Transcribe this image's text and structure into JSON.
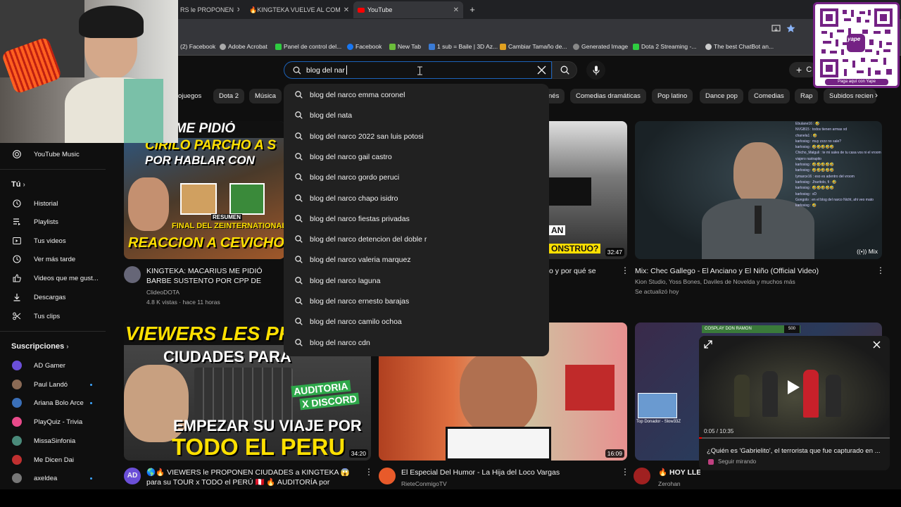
{
  "browser": {
    "tabs": [
      {
        "title": "RS le PROPONEN"
      },
      {
        "title": "🔥KINGTEKA VUELVE AL COM"
      },
      {
        "title": "YouTube"
      }
    ],
    "bookmarks": [
      "(2) Facebook",
      "Adobe Acrobat",
      "Panel de control del...",
      "Facebook",
      "New Tab",
      "1 sub = Baile | 3D Az...",
      "Cambiar Tamaño de...",
      "Generated Image",
      "Dota 2 Streaming -...",
      "The best ChatBot an..."
    ]
  },
  "search": {
    "query": "blog del nar",
    "suggestions": [
      "blog del narco emma coronel",
      "blog del nata",
      "blog del narco 2022 san luis potosi",
      "blog del narco gail castro",
      "blog del narco gordo peruci",
      "blog del narco chapo isidro",
      "blog del narco fiestas privadas",
      "blog del narco detencion del doble r",
      "blog del narco valeria marquez",
      "blog del narco laguna",
      "blog del narco ernesto barajas",
      "blog del narco camilo ochoa",
      "blog del narco cdn"
    ]
  },
  "header": {
    "create_label": "C"
  },
  "chips": [
    "ojuegos",
    "Dota 2",
    "Música",
    "nés",
    "Comedias dramáticas",
    "Pop latino",
    "Dance pop",
    "Comedias",
    "Rap",
    "Subidos recien"
  ],
  "sidebar": {
    "youtube_music": "YouTube Music",
    "you_section": "Tú",
    "items": [
      "Historial",
      "Playlists",
      "Tus videos",
      "Ver más tarde",
      "Videos que me gust...",
      "Descargas",
      "Tus clips"
    ],
    "subs_section": "Suscripciones",
    "subscriptions": [
      {
        "name": "AD Gamer",
        "color": "#6b4fd8",
        "new": false
      },
      {
        "name": "Paul Landó",
        "color": "#8a6a55",
        "new": true
      },
      {
        "name": "Ariana Bolo Arce",
        "color": "#3a6fb8",
        "new": true
      },
      {
        "name": "PlayQuiz - Trivia",
        "color": "#e84a8a",
        "new": false
      },
      {
        "name": "MissaSinfonia",
        "color": "#4a8a7a",
        "new": false
      },
      {
        "name": "Me Dicen Dai",
        "color": "#c03030",
        "new": false
      },
      {
        "name": "axeldea",
        "color": "#777777",
        "new": true
      }
    ]
  },
  "videos": {
    "v1": {
      "thumb_text": [
        "RIUS ME PIDIÓ",
        "CIRILO PARCHO A S",
        "POR HABLAR CON",
        "RESUMEN",
        "FINAL DEL ZEINTERNATIONAL",
        "REACCION A CEVICHON!!"
      ],
      "title": "KINGTEKA: MACARIUS ME PIDIÓ BARBE SUSTENTO POR CPP DE SIDERAL|REACCI",
      "channel": "ClideoDOTA",
      "stats": "4.8 K vistas · hace 11 horas"
    },
    "v2": {
      "duration": "32:47",
      "title": "o y por qué se",
      "thumb_text": [
        "AN",
        "ONSTRUO?"
      ]
    },
    "v3": {
      "mix_label": "Mix",
      "title": "Mix: Chec Gallego - El Anciano y El Niño (Official Video)",
      "channel": "Kion Studio, Yoss Bones, Daviles de Novelda y muchos más",
      "stats": "Se actualizó hoy"
    },
    "v4": {
      "thumb_text": [
        "VIEWERS LES PR",
        "CIUDADES PARA",
        "AUDITORIA",
        "X DISCORD",
        "EMPEZAR SU VIAJE POR",
        "TODO EL PERU"
      ],
      "duration": "34:20",
      "title": "🌎🔥 VIEWERS le PROPONEN CIUDADES a KINGTEKA 😱 para su TOUR x TODO el PERÚ 🇵🇪 🔥 AUDITORÍA por DISCORD"
    },
    "v5": {
      "duration": "16:09",
      "title": "El Especial Del Humor - La Hija del Loco Vargas",
      "channel": "RieteConmigoTV"
    },
    "v6": {
      "title": "🔥 HOY LLEU",
      "channel": "Zerohan",
      "overlay": "COSPLAY DON RAMON",
      "score": "500"
    }
  },
  "miniplayer": {
    "time": "0:05 / 10:35",
    "title": "¿Quién es 'Gabrielito', el terrorista que fue capturado en ...",
    "status": "Seguir mirando"
  },
  "overlay": {
    "qr_caption": "Paga aquí con Yape",
    "qr_brand": "yape",
    "chat": [
      "Ebulane16 : 🤣",
      "NVGB15 : todos tienen armas xd",
      "chanela1 : 🤣",
      "karlosisg : muy zzzz no sale?",
      "karlosisg : 🤣🤣🤣🤣🤣",
      "Chicho_Malguli : te mi sales de tu casa vos ni el vroom",
      "viajero rastrapito",
      "karlosisg : 🤣🤣🤣🤣🤣",
      "karlosisg : 🤣🤣🤣🤣🤣",
      "Iymarce16 : eso es adentro del vroom",
      "karlosisg : Jharitolo, fi : 🤣",
      "karlosisg : 🤣🤣🤣🤣🤣",
      "karlosisg : xD",
      "Gongolo : en el blog del narco Nicht, ahi veo mato",
      "karlosisg : 🤣"
    ],
    "mini_stream_label": "Top Donador - Slow33Z"
  }
}
